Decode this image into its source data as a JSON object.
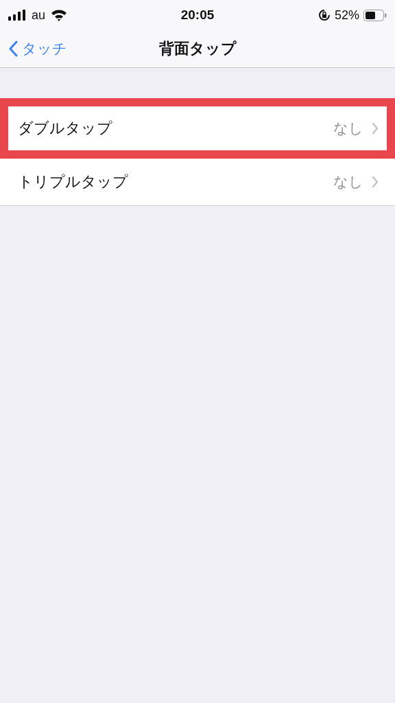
{
  "status_bar": {
    "carrier": "au",
    "time": "20:05",
    "battery_percent": "52%"
  },
  "nav": {
    "back": "タッチ",
    "title": "背面タップ"
  },
  "rows": [
    {
      "label": "ダブルタップ",
      "value": "なし",
      "highlighted": true
    },
    {
      "label": "トリプルタップ",
      "value": "なし",
      "highlighted": false
    }
  ]
}
